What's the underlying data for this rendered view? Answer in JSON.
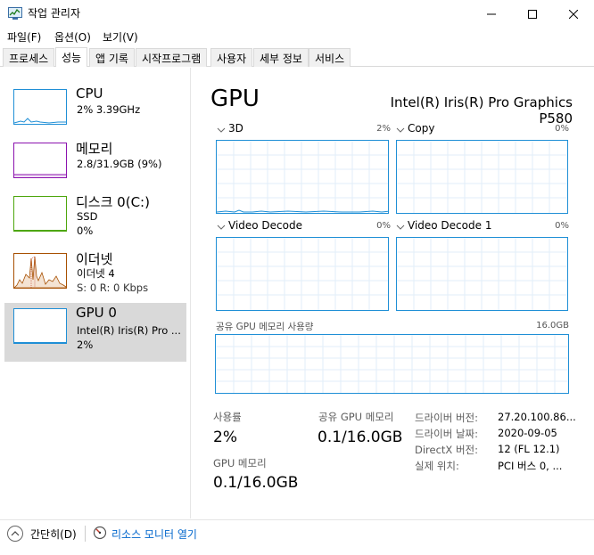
{
  "window": {
    "title": "작업 관리자"
  },
  "menu": [
    "파일(F)",
    "옵션(O)",
    "보기(V)"
  ],
  "tabs": [
    "프로세스",
    "성능",
    "앱 기록",
    "시작프로그램",
    "사용자",
    "세부 정보",
    "서비스"
  ],
  "sidebar": {
    "items": [
      {
        "name": "CPU",
        "sub1": "2% 3.39GHz",
        "sub2": "",
        "sub3": ""
      },
      {
        "name": "메모리",
        "sub1": "2.8/31.9GB (9%)",
        "sub2": "",
        "sub3": ""
      },
      {
        "name": "디스크 0(C:)",
        "sub1": "SSD",
        "sub2": "0%",
        "sub3": ""
      },
      {
        "name": "이더넷",
        "sub1": "이더넷 4",
        "sub2": "S: 0 R: 0 Kbps",
        "sub3": ""
      },
      {
        "name": "GPU 0",
        "sub1": "Intel(R) Iris(R) Pro ...",
        "sub2": "2%",
        "sub3": ""
      }
    ]
  },
  "gpu": {
    "title": "GPU",
    "model": "Intel(R) Iris(R) Pro Graphics P580",
    "graphs": [
      {
        "label": "3D",
        "pct": "2%"
      },
      {
        "label": "Copy",
        "pct": "0%"
      },
      {
        "label": "Video Decode",
        "pct": "0%"
      },
      {
        "label": "Video Decode 1",
        "pct": "0%"
      }
    ],
    "shared_mem_label": "공유 GPU 메모리 사용량",
    "shared_mem_max": "16.0GB",
    "stats": {
      "usage_label": "사용률",
      "usage_value": "2%",
      "shared_label": "공유 GPU 메모리",
      "shared_value": "0.1/16.0GB",
      "gpu_mem_label": "GPU 메모리",
      "gpu_mem_value": "0.1/16.0GB"
    },
    "info": [
      {
        "key": "드라이버 버전:",
        "value": "27.20.100.86..."
      },
      {
        "key": "드라이버 날짜:",
        "value": "2020-09-05"
      },
      {
        "key": "DirectX 버전:",
        "value": "12 (FL 12.1)"
      },
      {
        "key": "실제 위치:",
        "value": "PCI 버스 0, ..."
      }
    ]
  },
  "footer": {
    "collapse_label": "간단히(D)",
    "resmon_label": "리소스 모니터 열기"
  },
  "colors": {
    "cpu": "#1f8fd6",
    "memory": "#8b12ae",
    "disk": "#4da60c",
    "ethernet": "#a74f01",
    "gpu": "#1f8fd6"
  }
}
